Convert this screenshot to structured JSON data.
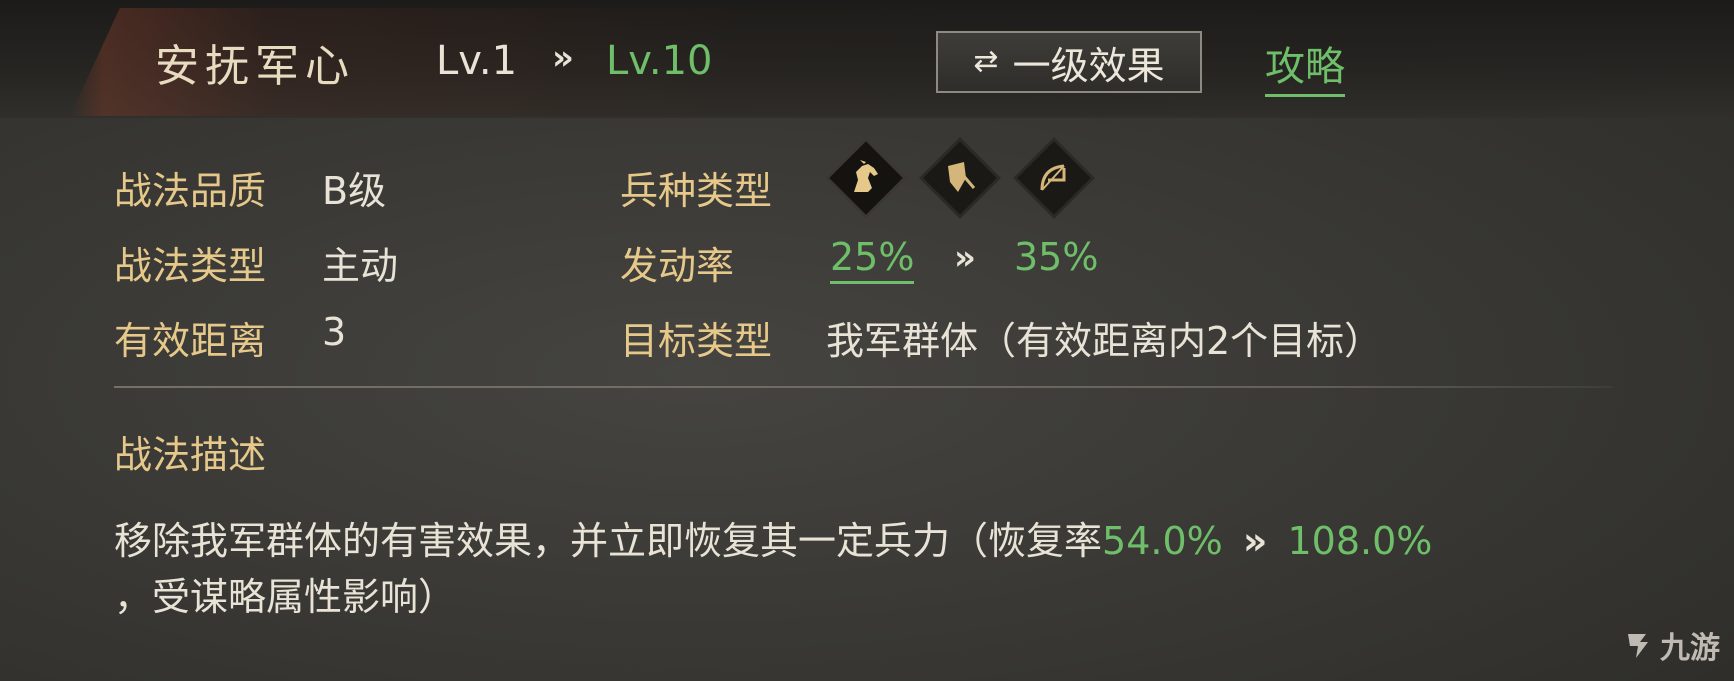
{
  "header": {
    "title": "安抚军心",
    "level_from": "Lv.1",
    "level_arrow": "»",
    "level_to": "Lv.10",
    "toggle_button_label": "一级效果",
    "guide_link": "攻略"
  },
  "stats": {
    "quality_label": "战法品质",
    "quality_value": "B级",
    "type_label": "战法类型",
    "type_value": "主动",
    "range_label": "有效距离",
    "range_value": "3",
    "troop_label": "兵种类型",
    "troop_icons": [
      "cavalry-icon",
      "shield-icon",
      "archer-icon"
    ],
    "rate_label": "发动率",
    "rate_from": "25%",
    "rate_arrow": "»",
    "rate_to": "35%",
    "target_label": "目标类型",
    "target_value": "我军群体（有效距离内2个目标）"
  },
  "description": {
    "heading": "战法描述",
    "line1_text": "移除我军群体的有害效果，并立即恢复其一定兵力（恢复率",
    "line1_value_from": "54.0%",
    "line1_arrow": "»",
    "line1_value_to": "108.0%",
    "line2_text": "，受谋略属性影响）"
  },
  "watermark": {
    "text": "九游"
  },
  "colors": {
    "accent_green": "#6fbf6a",
    "label_gold": "#e6c98a",
    "text_light": "#e8e3d6"
  }
}
